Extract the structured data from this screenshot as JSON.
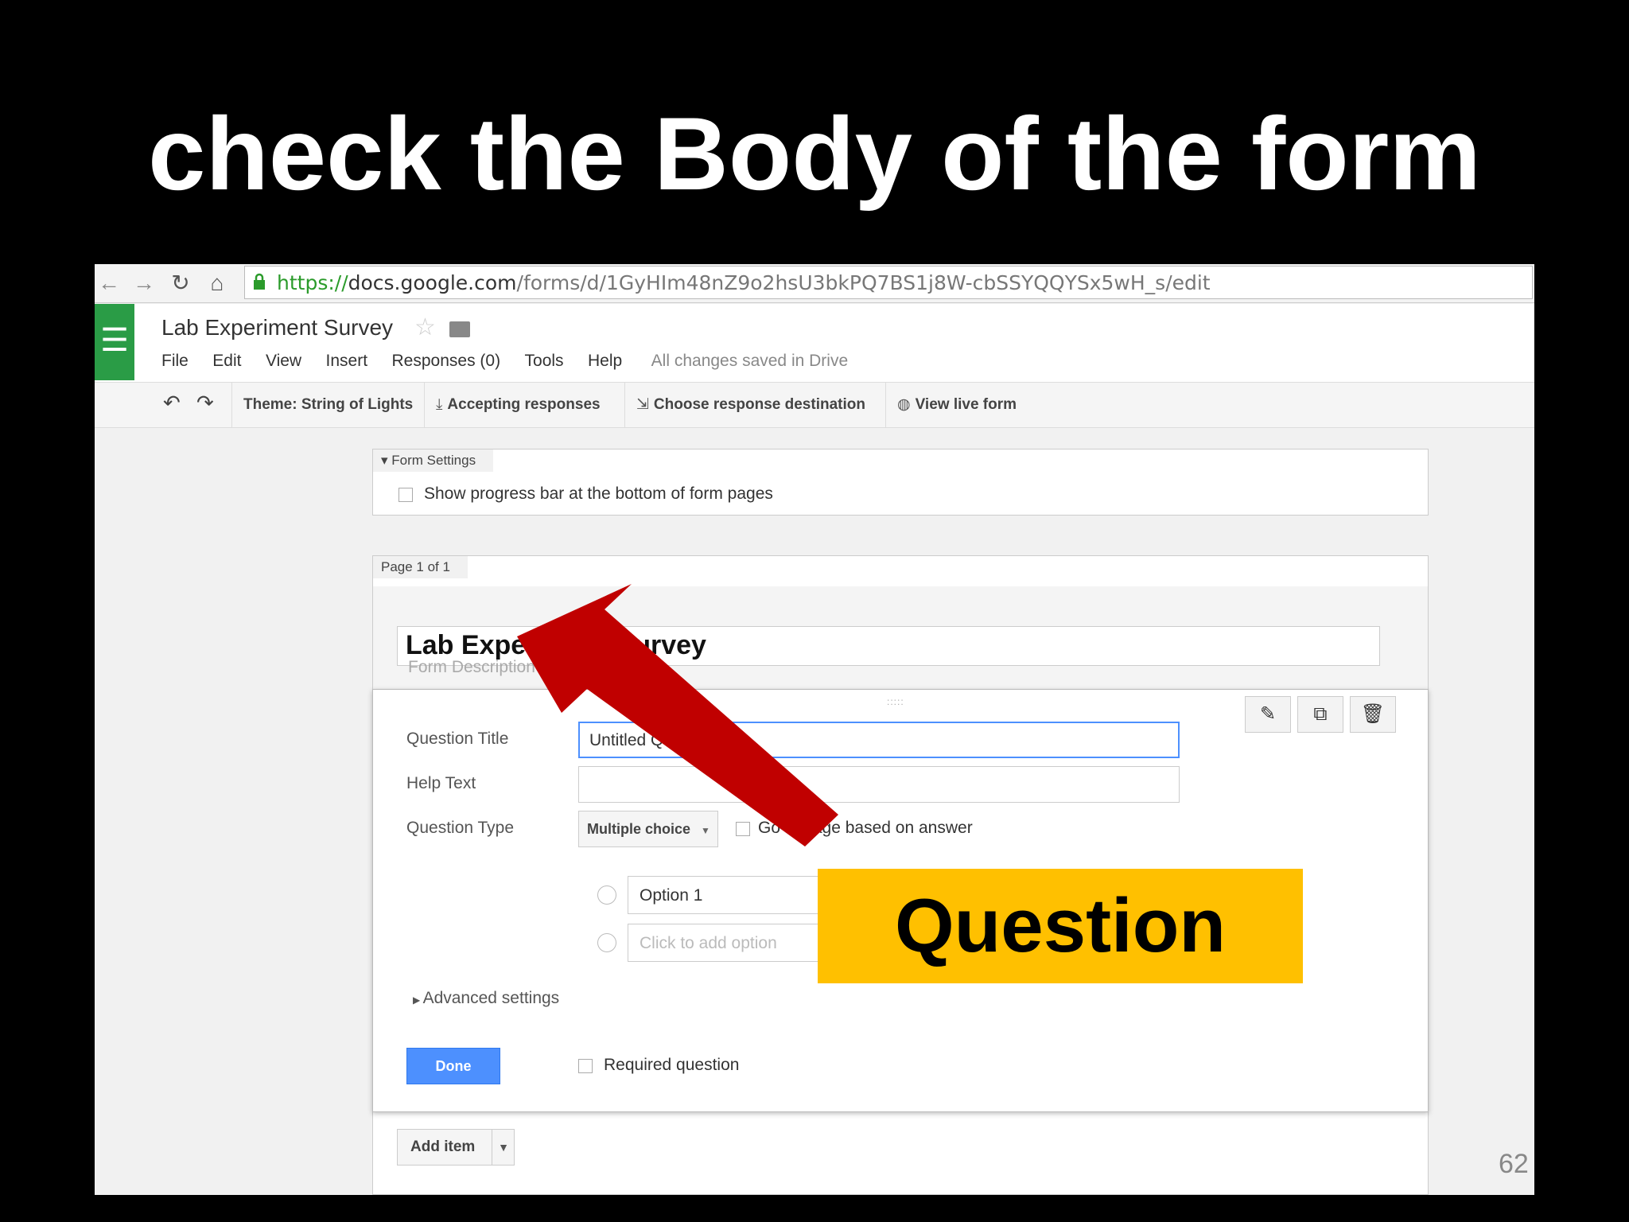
{
  "slide": {
    "title": "check the Body of the form",
    "page_number": "62"
  },
  "browser": {
    "url_scheme": "https://",
    "url_domain": "docs.google.com",
    "url_path": "/forms/d/1GyHIm48nZ9o2hsU3bkPQ7BS1j8W-cbSSYQQYSx5wH_s/edit"
  },
  "header": {
    "doc_title": "Lab Experiment Survey",
    "menu": [
      "File",
      "Edit",
      "View",
      "Insert",
      "Responses (0)",
      "Tools",
      "Help"
    ],
    "save_status": "All changes saved in Drive"
  },
  "toolbar": {
    "theme": "Theme: String of Lights",
    "accepting": "Accepting responses",
    "destination": "Choose response destination",
    "live": "View live form"
  },
  "form_settings": {
    "label": "Form Settings",
    "progress_bar": "Show progress bar at the bottom of form pages"
  },
  "page": {
    "label": "Page 1 of 1",
    "form_title": "Lab Experiment Survey",
    "form_description_placeholder": "Form Description"
  },
  "question": {
    "title_label": "Question Title",
    "title_value": "Untitled Question",
    "help_label": "Help Text",
    "type_label": "Question Type",
    "type_value": "Multiple choice",
    "go_to_page": "Go to page based on answer",
    "option1": "Option 1",
    "add_option": "Click to add option",
    "advanced": "Advanced settings",
    "done": "Done",
    "required": "Required question"
  },
  "add_item": "Add item",
  "callout": {
    "text": "Question",
    "arrow_color": "#c00000",
    "box_color": "#ffc000"
  },
  "colors": {
    "forms_green": "#2a9c46",
    "done_blue": "#4d90fe"
  }
}
